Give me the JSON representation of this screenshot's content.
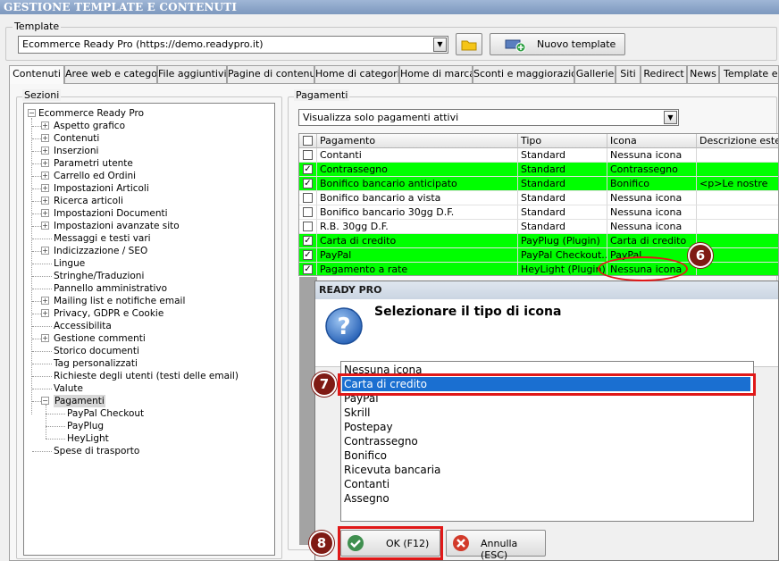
{
  "window": {
    "title": "GESTIONE TEMPLATE E CONTENUTI"
  },
  "template": {
    "group_label": "Template",
    "selected": "Ecommerce Ready Pro (https://demo.readypro.it)",
    "new_button_label": "Nuovo template"
  },
  "tabs": [
    {
      "label": "Contenuti",
      "active": true
    },
    {
      "label": "Aree web e categorie"
    },
    {
      "label": "File aggiuntivi"
    },
    {
      "label": "Pagine di contenuti"
    },
    {
      "label": "Home di categoria"
    },
    {
      "label": "Home di marca"
    },
    {
      "label": "Sconti e maggiorazioni"
    },
    {
      "label": "Gallerie"
    },
    {
      "label": "Siti"
    },
    {
      "label": "Redirect"
    },
    {
      "label": "News"
    },
    {
      "label": "Template e pl"
    }
  ],
  "sections": {
    "group_label": "Sezioni",
    "root": "Ecommerce Ready Pro",
    "items": [
      {
        "label": "Aspetto grafico",
        "expandable": true
      },
      {
        "label": "Contenuti",
        "expandable": true
      },
      {
        "label": "Inserzioni",
        "expandable": true
      },
      {
        "label": "Parametri utente",
        "expandable": true
      },
      {
        "label": "Carrello ed Ordini",
        "expandable": true
      },
      {
        "label": "Impostazioni Articoli",
        "expandable": true
      },
      {
        "label": "Ricerca articoli",
        "expandable": true
      },
      {
        "label": "Impostazioni Documenti",
        "expandable": true
      },
      {
        "label": "Impostazioni avanzate sito",
        "expandable": true
      },
      {
        "label": "Messaggi e testi vari",
        "expandable": false
      },
      {
        "label": "Indicizzazione / SEO",
        "expandable": true
      },
      {
        "label": "Lingue",
        "expandable": false
      },
      {
        "label": "Stringhe/Traduzioni",
        "expandable": false
      },
      {
        "label": "Pannello amministrativo",
        "expandable": false
      },
      {
        "label": "Mailing list e notifiche email",
        "expandable": true
      },
      {
        "label": "Privacy, GDPR e Cookie",
        "expandable": true
      },
      {
        "label": "Accessibilita",
        "expandable": false
      },
      {
        "label": "Gestione commenti",
        "expandable": true
      },
      {
        "label": "Storico documenti",
        "expandable": false
      },
      {
        "label": "Tag personalizzati",
        "expandable": false
      },
      {
        "label": "Richieste degli utenti (testi delle email)",
        "expandable": false
      },
      {
        "label": "Valute",
        "expandable": false
      },
      {
        "label": "Pagamenti",
        "expandable": true,
        "expanded": true,
        "selected": true,
        "children": [
          "PayPal Checkout",
          "PayPlug",
          "HeyLight"
        ]
      },
      {
        "label": "Spese di trasporto",
        "expandable": false
      }
    ]
  },
  "payments": {
    "group_label": "Pagamenti",
    "filter_selected": "Visualizza solo pagamenti attivi",
    "columns": [
      "Pagamento",
      "Tipo",
      "Icona",
      "Descrizione estesa"
    ],
    "rows": [
      {
        "checked": false,
        "active": false,
        "name": "Contanti",
        "type": "Standard",
        "icon": "Nessuna icona",
        "desc": ""
      },
      {
        "checked": true,
        "active": true,
        "name": "Contrassegno",
        "type": "Standard",
        "icon": "Contrassegno",
        "desc": ""
      },
      {
        "checked": true,
        "active": true,
        "name": "Bonifico bancario anticipato",
        "type": "Standard",
        "icon": "Bonifico",
        "desc": "<p>Le nostre"
      },
      {
        "checked": false,
        "active": false,
        "name": "Bonifico bancario a vista",
        "type": "Standard",
        "icon": "Nessuna icona",
        "desc": ""
      },
      {
        "checked": false,
        "active": false,
        "name": "Bonifico bancario 30gg D.F.",
        "type": "Standard",
        "icon": "Nessuna icona",
        "desc": ""
      },
      {
        "checked": false,
        "active": false,
        "name": "R.B. 30gg D.F.",
        "type": "Standard",
        "icon": "Nessuna icona",
        "desc": ""
      },
      {
        "checked": true,
        "active": true,
        "name": "Carta di credito",
        "type": "PayPlug (Plugin)",
        "icon": "Carta di credito",
        "desc": ""
      },
      {
        "checked": true,
        "active": true,
        "name": "PayPal",
        "type": "PayPal Checkout...",
        "icon": "PayPal",
        "desc": ""
      },
      {
        "checked": true,
        "active": true,
        "name": "Pagamento a rate",
        "type": "HeyLight (Plugin)",
        "icon": "Nessuna icona",
        "desc": ""
      }
    ]
  },
  "dialog": {
    "title": "READY PRO",
    "heading": "Selezionare il tipo di icona",
    "options": [
      "Nessuna icona",
      "Carta di credito",
      "PayPal",
      "Skrill",
      "Postepay",
      "Contrassegno",
      "Bonifico",
      "Ricevuta bancaria",
      "Contanti",
      "Assegno"
    ],
    "selected_index": 1,
    "ok_label": "OK (F12)",
    "cancel_label": "Annulla (ESC)"
  },
  "annotations": {
    "step6": "6",
    "step7": "7",
    "step8": "8"
  },
  "colors": {
    "active_row": "#00ff00",
    "selection": "#1a6fd1",
    "annotation_red": "#e01818",
    "marker": "#7f1a14"
  }
}
